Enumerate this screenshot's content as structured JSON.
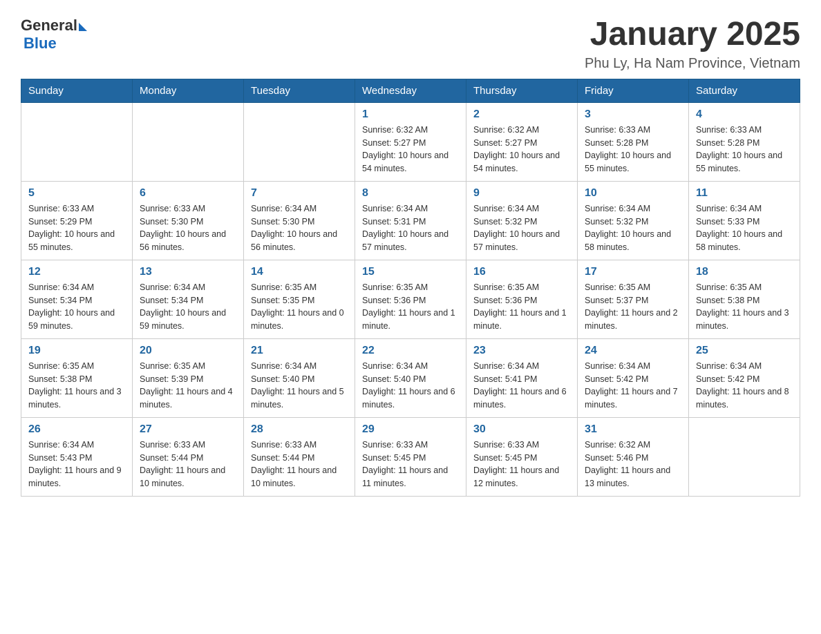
{
  "header": {
    "logo": {
      "general": "General",
      "blue": "Blue"
    },
    "title": "January 2025",
    "location": "Phu Ly, Ha Nam Province, Vietnam"
  },
  "days_of_week": [
    "Sunday",
    "Monday",
    "Tuesday",
    "Wednesday",
    "Thursday",
    "Friday",
    "Saturday"
  ],
  "weeks": [
    {
      "days": [
        {
          "number": "",
          "info": ""
        },
        {
          "number": "",
          "info": ""
        },
        {
          "number": "",
          "info": ""
        },
        {
          "number": "1",
          "info": "Sunrise: 6:32 AM\nSunset: 5:27 PM\nDaylight: 10 hours and 54 minutes."
        },
        {
          "number": "2",
          "info": "Sunrise: 6:32 AM\nSunset: 5:27 PM\nDaylight: 10 hours and 54 minutes."
        },
        {
          "number": "3",
          "info": "Sunrise: 6:33 AM\nSunset: 5:28 PM\nDaylight: 10 hours and 55 minutes."
        },
        {
          "number": "4",
          "info": "Sunrise: 6:33 AM\nSunset: 5:28 PM\nDaylight: 10 hours and 55 minutes."
        }
      ]
    },
    {
      "days": [
        {
          "number": "5",
          "info": "Sunrise: 6:33 AM\nSunset: 5:29 PM\nDaylight: 10 hours and 55 minutes."
        },
        {
          "number": "6",
          "info": "Sunrise: 6:33 AM\nSunset: 5:30 PM\nDaylight: 10 hours and 56 minutes."
        },
        {
          "number": "7",
          "info": "Sunrise: 6:34 AM\nSunset: 5:30 PM\nDaylight: 10 hours and 56 minutes."
        },
        {
          "number": "8",
          "info": "Sunrise: 6:34 AM\nSunset: 5:31 PM\nDaylight: 10 hours and 57 minutes."
        },
        {
          "number": "9",
          "info": "Sunrise: 6:34 AM\nSunset: 5:32 PM\nDaylight: 10 hours and 57 minutes."
        },
        {
          "number": "10",
          "info": "Sunrise: 6:34 AM\nSunset: 5:32 PM\nDaylight: 10 hours and 58 minutes."
        },
        {
          "number": "11",
          "info": "Sunrise: 6:34 AM\nSunset: 5:33 PM\nDaylight: 10 hours and 58 minutes."
        }
      ]
    },
    {
      "days": [
        {
          "number": "12",
          "info": "Sunrise: 6:34 AM\nSunset: 5:34 PM\nDaylight: 10 hours and 59 minutes."
        },
        {
          "number": "13",
          "info": "Sunrise: 6:34 AM\nSunset: 5:34 PM\nDaylight: 10 hours and 59 minutes."
        },
        {
          "number": "14",
          "info": "Sunrise: 6:35 AM\nSunset: 5:35 PM\nDaylight: 11 hours and 0 minutes."
        },
        {
          "number": "15",
          "info": "Sunrise: 6:35 AM\nSunset: 5:36 PM\nDaylight: 11 hours and 1 minute."
        },
        {
          "number": "16",
          "info": "Sunrise: 6:35 AM\nSunset: 5:36 PM\nDaylight: 11 hours and 1 minute."
        },
        {
          "number": "17",
          "info": "Sunrise: 6:35 AM\nSunset: 5:37 PM\nDaylight: 11 hours and 2 minutes."
        },
        {
          "number": "18",
          "info": "Sunrise: 6:35 AM\nSunset: 5:38 PM\nDaylight: 11 hours and 3 minutes."
        }
      ]
    },
    {
      "days": [
        {
          "number": "19",
          "info": "Sunrise: 6:35 AM\nSunset: 5:38 PM\nDaylight: 11 hours and 3 minutes."
        },
        {
          "number": "20",
          "info": "Sunrise: 6:35 AM\nSunset: 5:39 PM\nDaylight: 11 hours and 4 minutes."
        },
        {
          "number": "21",
          "info": "Sunrise: 6:34 AM\nSunset: 5:40 PM\nDaylight: 11 hours and 5 minutes."
        },
        {
          "number": "22",
          "info": "Sunrise: 6:34 AM\nSunset: 5:40 PM\nDaylight: 11 hours and 6 minutes."
        },
        {
          "number": "23",
          "info": "Sunrise: 6:34 AM\nSunset: 5:41 PM\nDaylight: 11 hours and 6 minutes."
        },
        {
          "number": "24",
          "info": "Sunrise: 6:34 AM\nSunset: 5:42 PM\nDaylight: 11 hours and 7 minutes."
        },
        {
          "number": "25",
          "info": "Sunrise: 6:34 AM\nSunset: 5:42 PM\nDaylight: 11 hours and 8 minutes."
        }
      ]
    },
    {
      "days": [
        {
          "number": "26",
          "info": "Sunrise: 6:34 AM\nSunset: 5:43 PM\nDaylight: 11 hours and 9 minutes."
        },
        {
          "number": "27",
          "info": "Sunrise: 6:33 AM\nSunset: 5:44 PM\nDaylight: 11 hours and 10 minutes."
        },
        {
          "number": "28",
          "info": "Sunrise: 6:33 AM\nSunset: 5:44 PM\nDaylight: 11 hours and 10 minutes."
        },
        {
          "number": "29",
          "info": "Sunrise: 6:33 AM\nSunset: 5:45 PM\nDaylight: 11 hours and 11 minutes."
        },
        {
          "number": "30",
          "info": "Sunrise: 6:33 AM\nSunset: 5:45 PM\nDaylight: 11 hours and 12 minutes."
        },
        {
          "number": "31",
          "info": "Sunrise: 6:32 AM\nSunset: 5:46 PM\nDaylight: 11 hours and 13 minutes."
        },
        {
          "number": "",
          "info": ""
        }
      ]
    }
  ]
}
